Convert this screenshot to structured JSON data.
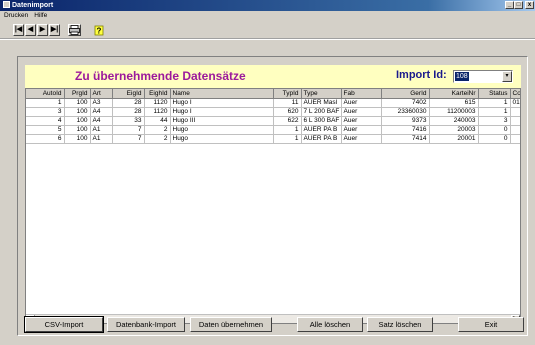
{
  "window": {
    "title": "Datenimport",
    "min": "_",
    "max": "□",
    "close": "x"
  },
  "menu": [
    "Drucken",
    "Hilfe"
  ],
  "toolbar": {
    "first": "|◀",
    "prev": "◀",
    "next": "▶",
    "last": "▶|"
  },
  "header": {
    "title": "Zu übernehmende Datensätze",
    "import_label": "Import Id:",
    "import_value": "108",
    "dropdown_arrow": "▾"
  },
  "table": {
    "columns": [
      "AutoId",
      "PrgId",
      "Art",
      "EigId",
      "EighId",
      "Name",
      "TypId",
      "Type",
      "Fab",
      "GerId",
      "KarteiNr",
      "Status",
      "Co"
    ],
    "rows": [
      [
        "1",
        "100",
        "A3",
        "28",
        "1120",
        "Hugo I",
        "11",
        "AUER Masl",
        "Auer",
        "7402",
        "615",
        "1",
        "010"
      ],
      [
        "3",
        "100",
        "A4",
        "28",
        "1120",
        "Hugo I",
        "620",
        "7 L 200 BAF",
        "Auer",
        "23360030",
        "11200003",
        "1",
        ""
      ],
      [
        "4",
        "100",
        "A4",
        "33",
        "44",
        "Hugo III",
        "622",
        "6 L 300 BAF",
        "Auer",
        "9373",
        "240003",
        "3",
        ""
      ],
      [
        "5",
        "100",
        "A1",
        "7",
        "2",
        "Hugo",
        "1",
        "AUER PA B",
        "Auer",
        "7416",
        "20003",
        "0",
        ""
      ],
      [
        "6",
        "100",
        "A1",
        "7",
        "2",
        "Hugo",
        "1",
        "AUER PA B",
        "Auer",
        "7414",
        "20001",
        "0",
        ""
      ]
    ]
  },
  "scroll": {
    "left": "◀",
    "right": "▶"
  },
  "buttons": {
    "csv_import": "CSV-Import",
    "db_import": "Datenbank-Import",
    "take_over": "Daten übernehmen",
    "delete_all": "Alle löschen",
    "delete_record": "Satz löschen",
    "exit": "Exit"
  },
  "colors": {
    "header_bg": "#ffffc0",
    "title": "#9c1a9c",
    "import_label": "#1a1a8c",
    "face": "#d4d0c8"
  }
}
